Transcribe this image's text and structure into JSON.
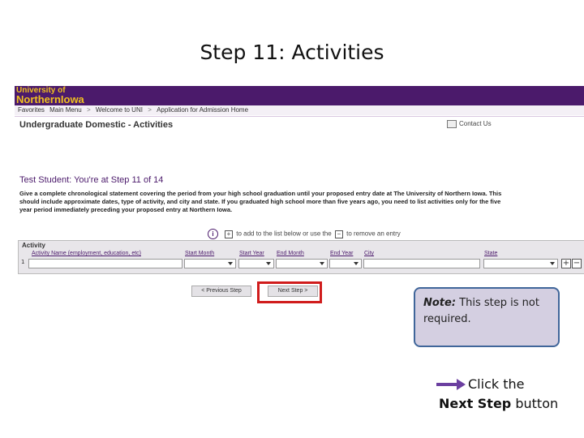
{
  "slide": {
    "title": "Step 11:  Activities"
  },
  "site": {
    "logo_line1": "University of",
    "logo_line2": "NorthernIowa",
    "nav": {
      "favorites": "Favorites",
      "main_menu": "Main Menu",
      "welcome": "Welcome to UNI",
      "home": "Application for Admission Home"
    },
    "page_heading": "Undergraduate Domestic - Activities",
    "contact_label": "Contact Us",
    "step_text": "Test Student: You're at Step 11 of 14",
    "instructions": "Give a complete chronological statement covering the period from your high school graduation until your proposed entry date at The University of Northern Iowa. This should include approximate dates, type of activity, and city and state. If you graduated high school more than five years ago, you need to list activities only for the five year period immediately preceding your proposed entry at Northern Iowa.",
    "help_text_1": "to add to the list below or use the",
    "help_text_2": "to remove an entry",
    "grid": {
      "title": "Activity",
      "columns": [
        "Activity Name (employment, education, etc)",
        "Start Month",
        "Start Year",
        "End Month",
        "End Year",
        "City",
        "State"
      ],
      "row_index": "1"
    },
    "buttons": {
      "previous": "< Previous Step",
      "next": "Next Step >"
    }
  },
  "callout": {
    "note_label": "Note:",
    "note_text": "This step is not required.",
    "click_line": "Click the",
    "next_step_bold": "Next Step",
    "button_word": "button"
  },
  "colors": {
    "brand_purple": "#4b1a6b",
    "brand_gold": "#f0c020",
    "highlight_red": "#d01c1c",
    "note_fill": "#d4cfe1",
    "arrow_purple": "#6b3fa0"
  }
}
